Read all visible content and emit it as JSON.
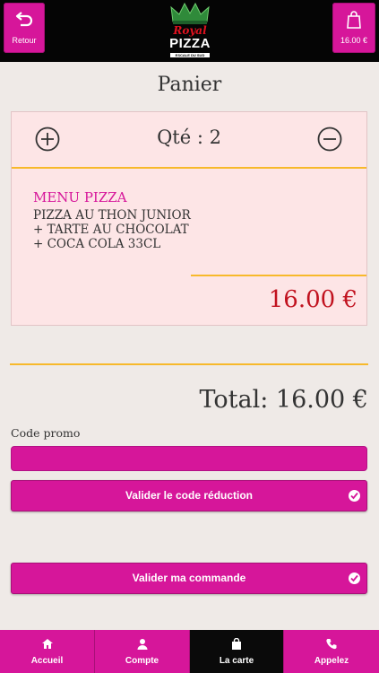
{
  "header": {
    "back_label": "Retour",
    "cart_label": "16.00 €",
    "logo": {
      "royal": "Royal",
      "pizza": "PIZZA",
      "tagline": "ESCALE DU SUD"
    }
  },
  "page_title": "Panier",
  "cart_item": {
    "quantity_text": "Qté : 2",
    "menu_name": "MENU PIZZA",
    "lines": [
      "PIZZA AU THON JUNIOR",
      "+ TARTE AU CHOCOLAT",
      "+ COCA COLA 33CL"
    ],
    "price": "16.00 €"
  },
  "total_text": "Total: 16.00 €",
  "promo": {
    "label": "Code promo",
    "value": "",
    "placeholder": ""
  },
  "buttons": {
    "validate_code": "Valider le code réduction",
    "validate_order": "Valider ma commande"
  },
  "tabs": [
    {
      "label": "Accueil",
      "icon": "home-icon"
    },
    {
      "label": "Compte",
      "icon": "user-icon"
    },
    {
      "label": "La carte",
      "icon": "bag-icon",
      "active": true
    },
    {
      "label": "Appelez",
      "icon": "phone-icon"
    }
  ],
  "colors": {
    "accent": "#d6169a",
    "price": "#c1121f",
    "divider": "#f7b92b",
    "card": "#fde5e6",
    "header": "#050505"
  }
}
